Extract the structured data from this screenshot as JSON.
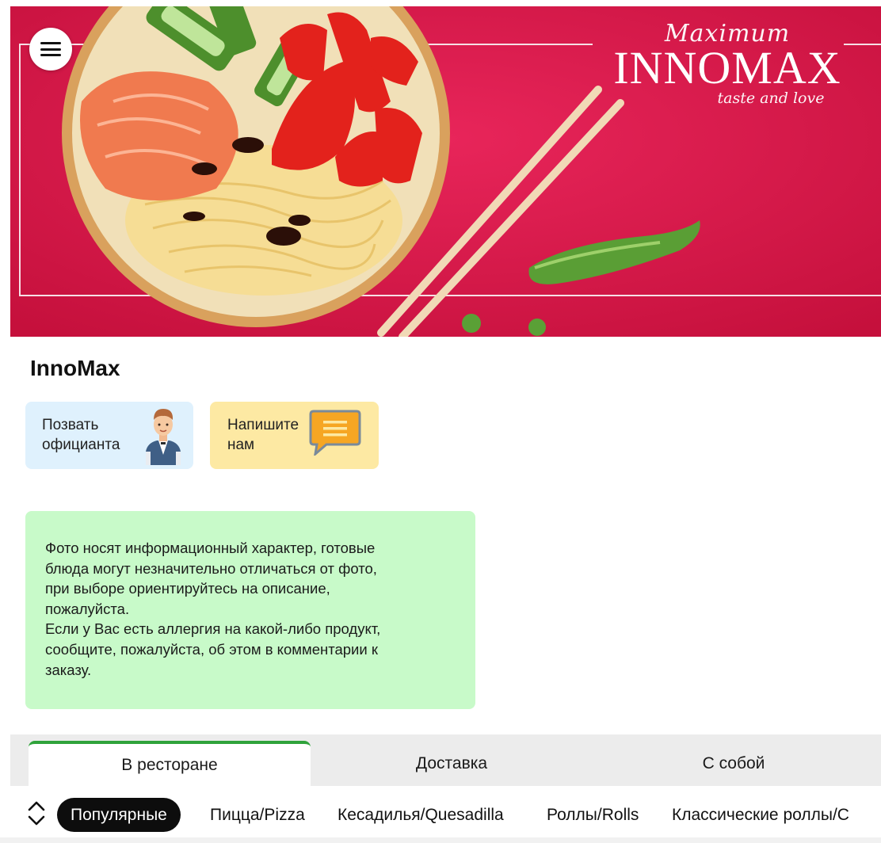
{
  "hero": {
    "brand_script_top": "Maximum",
    "brand_wordmark": "INNOMAX",
    "brand_script_bottom": "taste and love",
    "background_color": "#e0174a"
  },
  "menu": {
    "icon": "hamburger-menu-icon"
  },
  "place": {
    "title": "InnoMax"
  },
  "actions": {
    "call_waiter": {
      "label": "Позвать\nофицианта",
      "icon": "waiter-icon",
      "color": "#dff1fd"
    },
    "write_us": {
      "label": "Напишите\nнам",
      "icon": "chat-bubble-icon",
      "color": "#fde9a3"
    }
  },
  "notice": {
    "text": "Фото носят информационный характер, готовые\nблюда могут незначительно отличаться от фото,\nпри выборе ориентируйтесь на описание,\nпожалуйста.\nЕсли у Вас есть аллергия на какой-либо продукт,\nсообщите, пожалуйста, об этом в комментарии к\nзаказу.",
    "color": "#c8fac9"
  },
  "tabs": [
    {
      "label": "В ресторане",
      "active": true
    },
    {
      "label": "Доставка",
      "active": false
    },
    {
      "label": "С собой",
      "active": false
    }
  ],
  "tab_accent_color": "#2fa33b",
  "categories": [
    {
      "label": "Популярные",
      "active": true
    },
    {
      "label": "Пицца/Pizza",
      "active": false
    },
    {
      "label": "Кесадилья/Quesadilla",
      "active": false
    },
    {
      "label": "Роллы/Rolls",
      "active": false
    },
    {
      "label": "Классические роллы/C",
      "active": false
    }
  ]
}
